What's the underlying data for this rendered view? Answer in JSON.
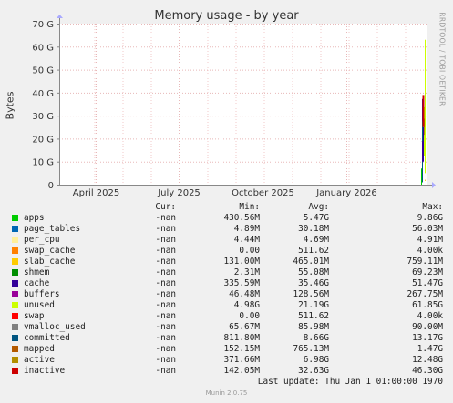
{
  "chart_data": {
    "type": "area",
    "title": "Memory usage - by year",
    "ylabel": "Bytes",
    "ylim": [
      0,
      70
    ],
    "y_unit": "G",
    "y_ticks": [
      "0",
      "10 G",
      "20 G",
      "30 G",
      "40 G",
      "50 G",
      "60 G",
      "70 G"
    ],
    "x_ticks": [
      "April 2025",
      "July 2025",
      "October 2025",
      "January 2026"
    ],
    "grid": true,
    "series": [
      {
        "name": "apps",
        "values": [
          5.47
        ]
      },
      {
        "name": "page_tables",
        "values": [
          0.03
        ]
      },
      {
        "name": "per_cpu",
        "values": [
          0.005
        ]
      },
      {
        "name": "swap_cache",
        "values": [
          0
        ]
      },
      {
        "name": "slab_cache",
        "values": [
          0.47
        ]
      },
      {
        "name": "shmem",
        "values": [
          0.06
        ]
      },
      {
        "name": "cache",
        "values": [
          35.46
        ]
      },
      {
        "name": "buffers",
        "values": [
          0.13
        ]
      },
      {
        "name": "unused",
        "values": [
          21.19
        ]
      },
      {
        "name": "swap",
        "values": [
          0
        ]
      },
      {
        "name": "vmalloc_used",
        "values": [
          0.09
        ]
      },
      {
        "name": "committed",
        "values": [
          8.66
        ]
      },
      {
        "name": "mapped",
        "values": [
          0.77
        ]
      },
      {
        "name": "active",
        "values": [
          6.98
        ]
      },
      {
        "name": "inactive",
        "values": [
          32.63
        ]
      }
    ]
  },
  "side_label": "RRDTOOL / TOBI OETIKER",
  "legend": {
    "headers": {
      "cur": "Cur:",
      "min": "Min:",
      "avg": "Avg:",
      "max": "Max:"
    },
    "rows": [
      {
        "name": "apps",
        "color": "#00cc00",
        "cur": "-nan",
        "min": "430.56M",
        "avg": "5.47G",
        "max": "9.86G"
      },
      {
        "name": "page_tables",
        "color": "#0066b3",
        "cur": "-nan",
        "min": "4.89M",
        "avg": "30.18M",
        "max": "56.03M"
      },
      {
        "name": "per_cpu",
        "color": "#ffee99",
        "cur": "-nan",
        "min": "4.44M",
        "avg": "4.69M",
        "max": "4.91M"
      },
      {
        "name": "swap_cache",
        "color": "#ff8000",
        "cur": "-nan",
        "min": "0.00",
        "avg": "511.62",
        "max": "4.00k"
      },
      {
        "name": "slab_cache",
        "color": "#ffcc00",
        "cur": "-nan",
        "min": "131.00M",
        "avg": "465.01M",
        "max": "759.11M"
      },
      {
        "name": "shmem",
        "color": "#008f00",
        "cur": "-nan",
        "min": "2.31M",
        "avg": "55.08M",
        "max": "69.23M"
      },
      {
        "name": "cache",
        "color": "#330099",
        "cur": "-nan",
        "min": "335.59M",
        "avg": "35.46G",
        "max": "51.47G"
      },
      {
        "name": "buffers",
        "color": "#990099",
        "cur": "-nan",
        "min": "46.48M",
        "avg": "128.56M",
        "max": "267.75M"
      },
      {
        "name": "unused",
        "color": "#ccff00",
        "cur": "-nan",
        "min": "4.98G",
        "avg": "21.19G",
        "max": "61.85G"
      },
      {
        "name": "swap",
        "color": "#ff0000",
        "cur": "-nan",
        "min": "0.00",
        "avg": "511.62",
        "max": "4.00k"
      },
      {
        "name": "vmalloc_used",
        "color": "#808080",
        "cur": "-nan",
        "min": "65.67M",
        "avg": "85.98M",
        "max": "90.00M"
      },
      {
        "name": "committed",
        "color": "#005580",
        "cur": "-nan",
        "min": "811.80M",
        "avg": "8.66G",
        "max": "13.17G"
      },
      {
        "name": "mapped",
        "color": "#b35a00",
        "cur": "-nan",
        "min": "152.15M",
        "avg": "765.13M",
        "max": "1.47G"
      },
      {
        "name": "active",
        "color": "#b38f00",
        "cur": "-nan",
        "min": "371.66M",
        "avg": "6.98G",
        "max": "12.48G"
      },
      {
        "name": "inactive",
        "color": "#cc0000",
        "cur": "-nan",
        "min": "142.05M",
        "avg": "32.63G",
        "max": "46.30G"
      }
    ]
  },
  "last_update": "Last update: Thu Jan  1 01:00:00 1970",
  "footer": "Munin 2.0.75"
}
